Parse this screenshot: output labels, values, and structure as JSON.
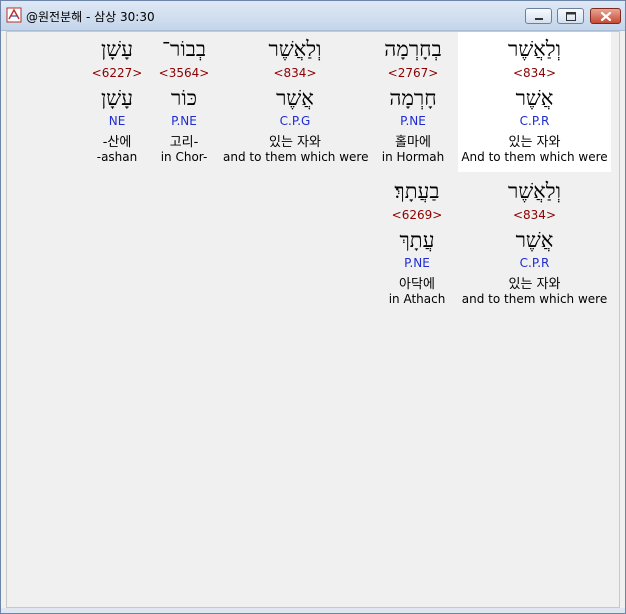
{
  "window": {
    "title": "@원전분해 - 삼상 30:30"
  },
  "rows": [
    {
      "cells": [
        {
          "hebrew": "וְלַאֲשֶׁר",
          "strong": "<834>",
          "root": "אֲשֶׁר",
          "morph": "C.P.R",
          "korean": "있는 자와",
          "english": "And to them which were",
          "selected": true
        },
        {
          "hebrew": "בְחָרְמָה",
          "strong": "<2767>",
          "root": "חָרְמָה",
          "morph": "P.NE",
          "korean": "홀마에",
          "english": "in Hormah",
          "selected": false
        },
        {
          "hebrew": "וְלַאֲשֶׁר",
          "strong": "<834>",
          "root": "אֲשֶׁר",
          "morph": "C.P.G",
          "korean": "있는 자와",
          "english": "and to them which were",
          "selected": false
        },
        {
          "hebrew": "בְבוֹר־",
          "strong": "<3564>",
          "root": "כּוֹר",
          "morph": "P.NE",
          "korean": "고리-",
          "english": "in Chor-",
          "selected": false
        },
        {
          "hebrew": "עָשָׁן",
          "strong": "<6227>",
          "root": "עָשָׁן",
          "morph": "NE",
          "korean": "-산에",
          "english": "-ashan",
          "selected": false
        }
      ]
    },
    {
      "cells": [
        {
          "hebrew": "וְלַאֲשֶׁר",
          "strong": "<834>",
          "root": "אֲשֶׁר",
          "morph": "C.P.R",
          "korean": "있는 자와",
          "english": "and to them which were",
          "selected": false
        },
        {
          "hebrew": "בַעֲתָךְ׃",
          "strong": "<6269>",
          "root": "עֲתָךְ",
          "morph": "P.NE",
          "korean": "아닥에",
          "english": "in Athach",
          "selected": false
        }
      ]
    }
  ]
}
